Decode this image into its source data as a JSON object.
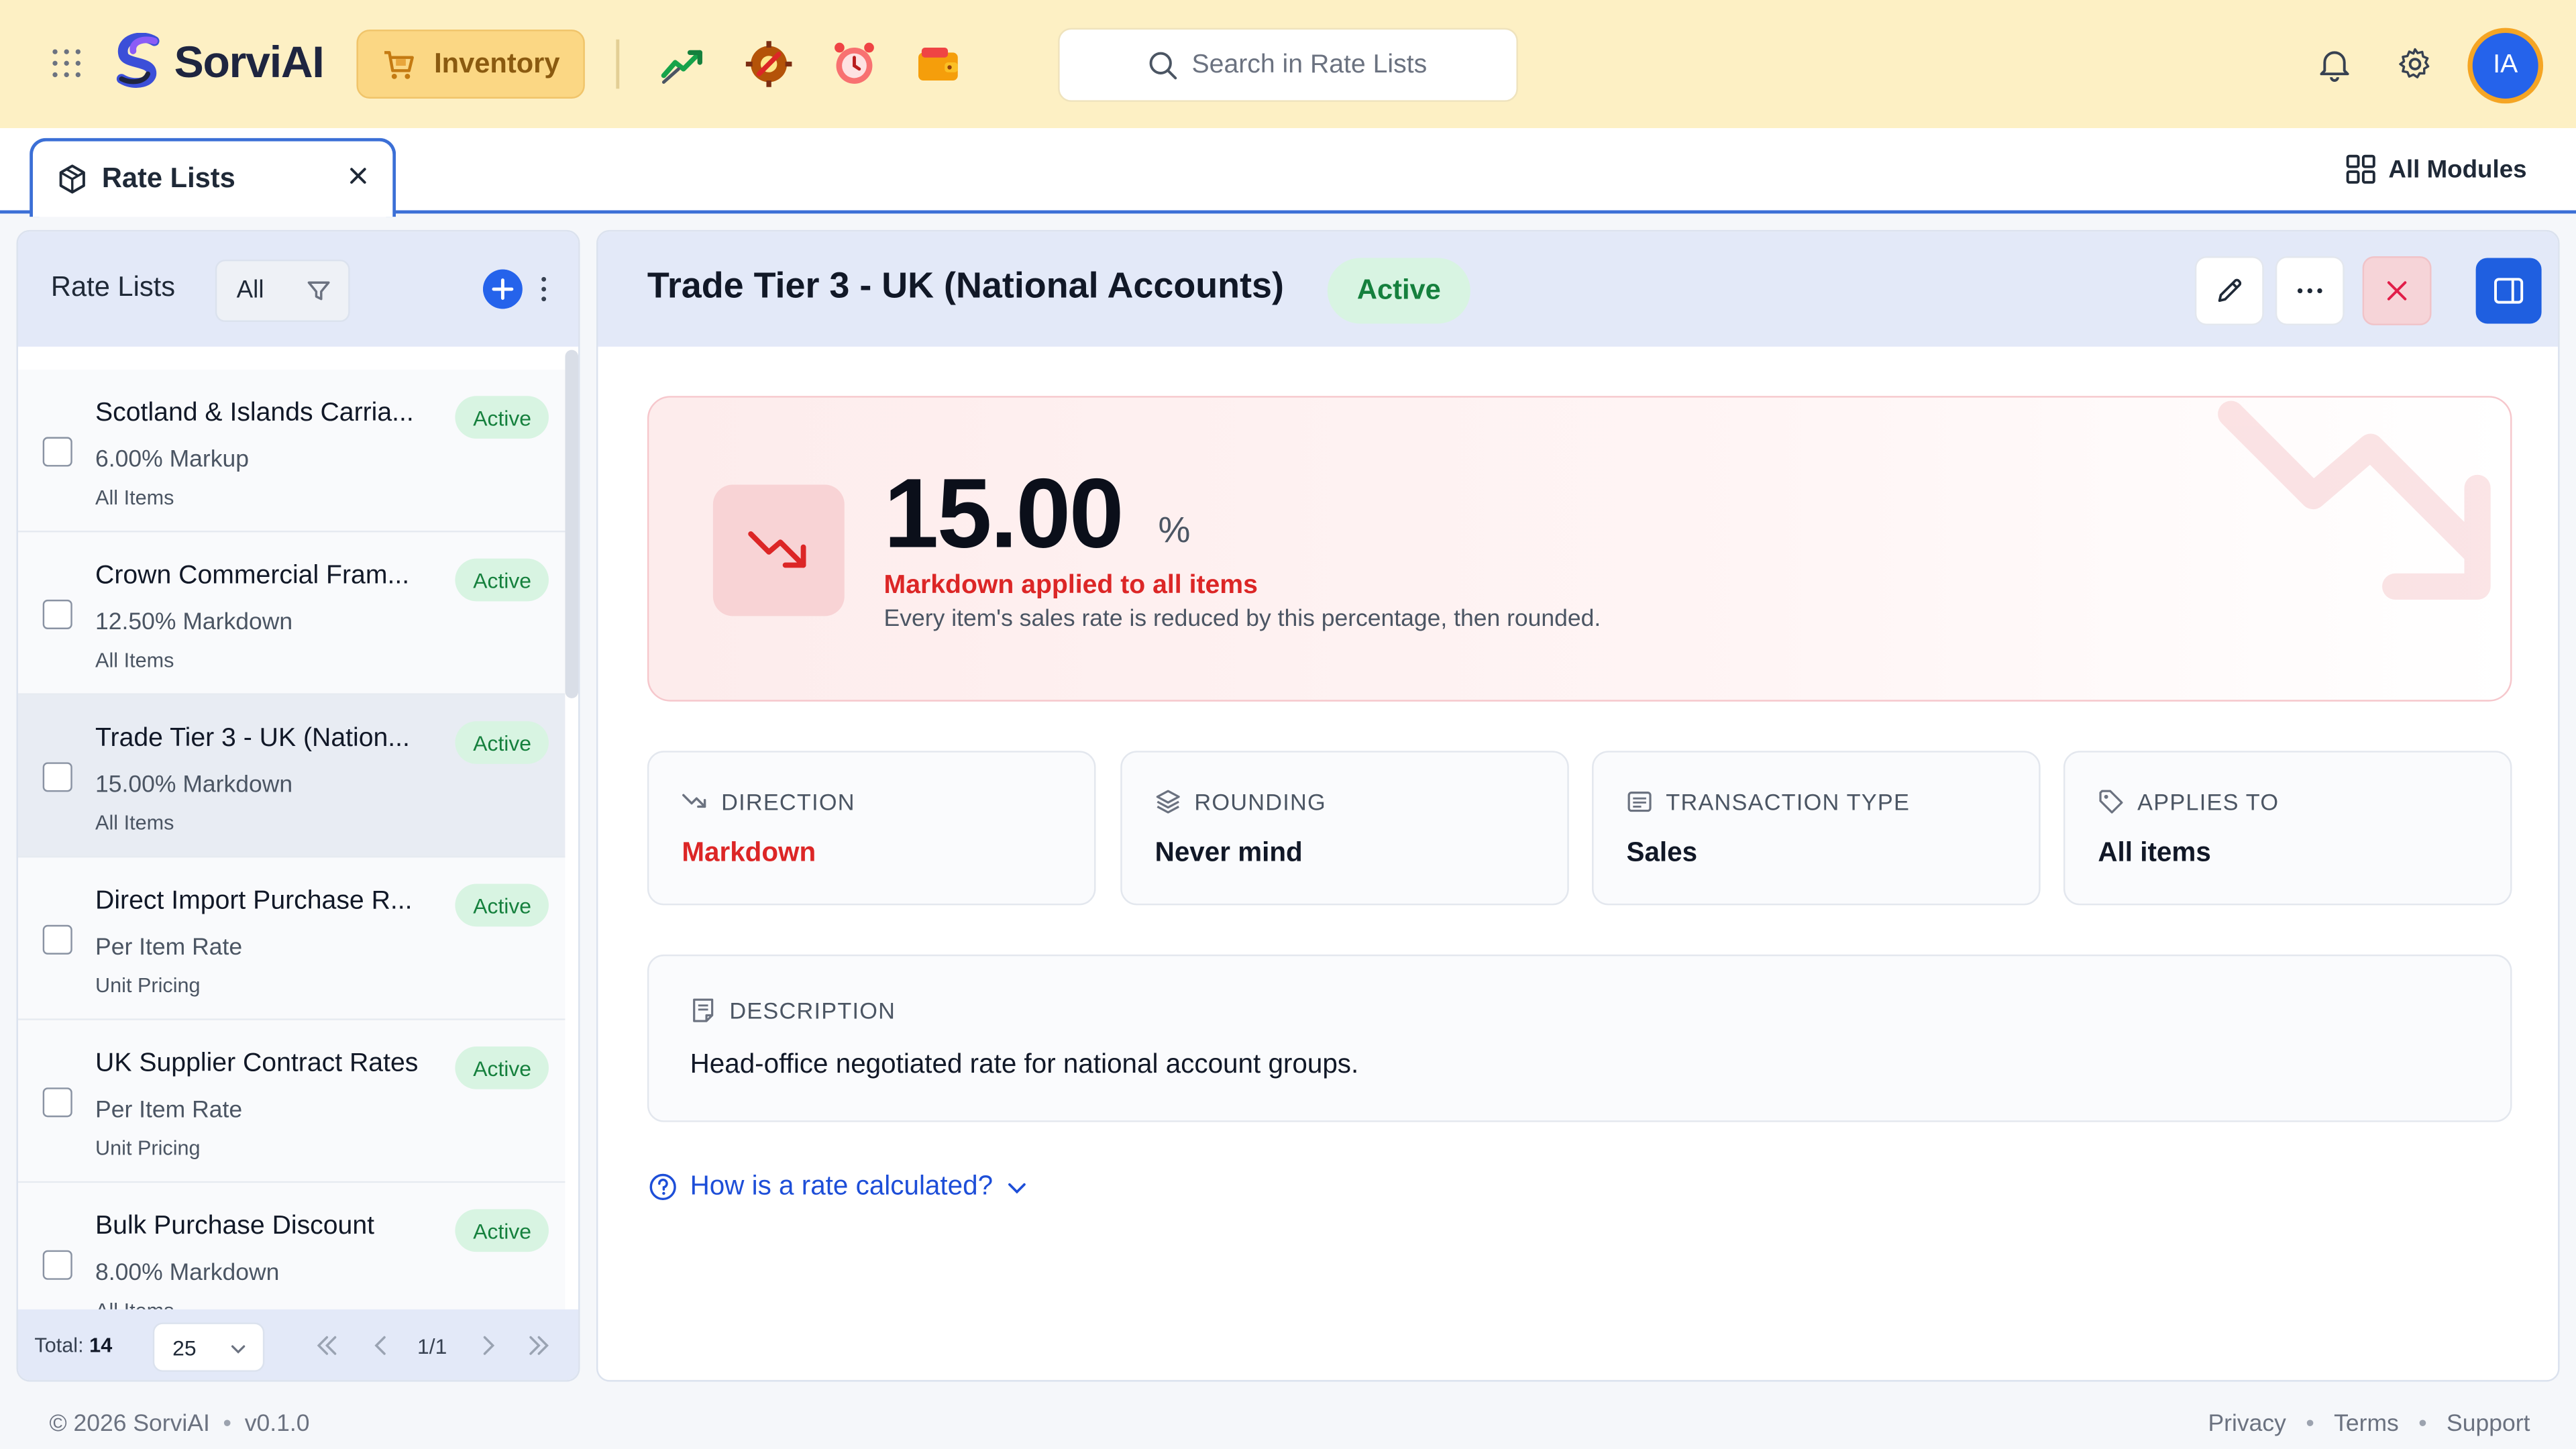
{
  "app": {
    "brand": "SorviAI",
    "module": "Inventory",
    "search_placeholder": "Search in Rate Lists",
    "user_initials": "IA",
    "accent": "#2563eb",
    "topbar_bg": "#fdf0c4"
  },
  "icons": {
    "quick": [
      "trend-up-icon",
      "gear-wrench-icon",
      "alarm-clock-icon",
      "wallet-icon"
    ],
    "top_right": [
      "bell-icon",
      "settings-icon"
    ]
  },
  "tabs": [
    {
      "label": "Rate Lists"
    }
  ],
  "all_modules_label": "All Modules",
  "list_panel": {
    "title": "Rate Lists",
    "filter_label": "All",
    "items": [
      {
        "name": "Scotland & Islands Carria...",
        "badge": "Active",
        "sub": "6.00% Markup",
        "sub2": "All Items"
      },
      {
        "name": "Crown Commercial Fram...",
        "badge": "Active",
        "sub": "12.50% Markdown",
        "sub2": "All Items"
      },
      {
        "name": "Trade Tier 3 - UK (Nation...",
        "badge": "Active",
        "sub": "15.00% Markdown",
        "sub2": "All Items"
      },
      {
        "name": "Direct Import Purchase R...",
        "badge": "Active",
        "sub": "Per Item Rate",
        "sub2": "Unit Pricing"
      },
      {
        "name": "UK Supplier Contract Rates",
        "badge": "Active",
        "sub": "Per Item Rate",
        "sub2": "Unit Pricing"
      },
      {
        "name": "Bulk Purchase Discount",
        "badge": "Active",
        "sub": "8.00% Markdown",
        "sub2": "All Items"
      }
    ],
    "total_label": "Total:",
    "total": "14",
    "page_size": "25",
    "page": "1/1"
  },
  "detail": {
    "title": "Trade Tier 3 - UK (National Accounts)",
    "status": "Active",
    "value": "15.00",
    "unit": "%",
    "headline": "Markdown applied to all items",
    "explanation": "Every item's sales rate is reduced by this percentage, then rounded.",
    "cards": [
      {
        "label": "DIRECTION",
        "value": "Markdown"
      },
      {
        "label": "ROUNDING",
        "value": "Never mind"
      },
      {
        "label": "TRANSACTION TYPE",
        "value": "Sales"
      },
      {
        "label": "APPLIES TO",
        "value": "All items"
      }
    ],
    "description_label": "DESCRIPTION",
    "description": "Head-office negotiated rate for national account groups.",
    "how_link": "How is a rate calculated?"
  },
  "footer": {
    "copyright": "© 2026 SorviAI",
    "version": "v0.1.0",
    "links": [
      "Privacy",
      "Terms",
      "Support"
    ]
  }
}
